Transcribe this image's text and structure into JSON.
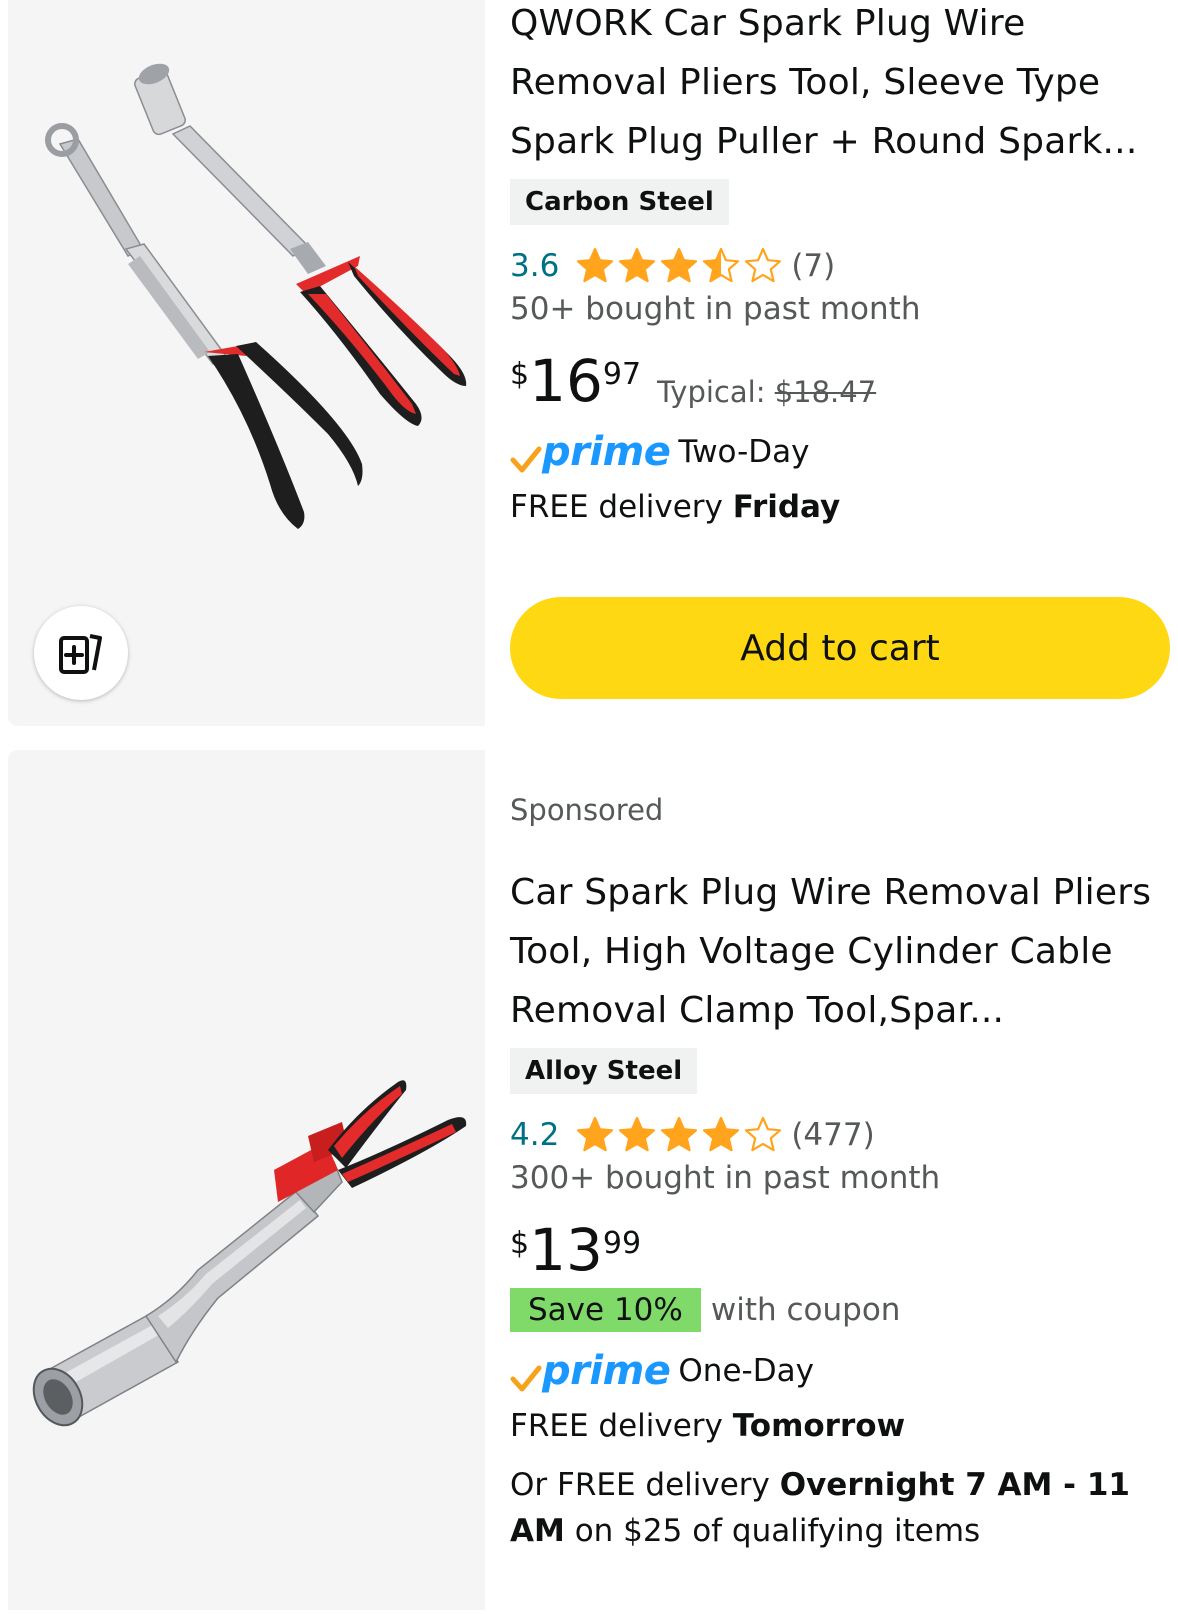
{
  "products": [
    {
      "title": "QWORK Car Spark Plug Wire Removal Pliers Tool, Sleeve Type Spark Plug Puller + Round Spark...",
      "material": "Carbon Steel",
      "rating": "3.6",
      "rating_value": 3.6,
      "rating_count": "(7)",
      "bought": "50+ bought in past month",
      "price_symbol": "$",
      "price_whole": "16",
      "price_fraction": "97",
      "typical_label": "Typical:",
      "typical_price": "$18.47",
      "prime_word": "prime",
      "prime_speed": "Two-Day",
      "delivery_prefix": "FREE delivery",
      "delivery_day": "Friday",
      "add_to_cart": "Add to cart"
    },
    {
      "sponsored": "Sponsored",
      "title": "Car Spark Plug Wire Removal Pliers Tool, High Voltage Cylinder Cable Removal Clamp Tool,Spar...",
      "material": "Alloy Steel",
      "rating": "4.2",
      "rating_value": 4.2,
      "rating_count": "(477)",
      "bought": "300+ bought in past month",
      "price_symbol": "$",
      "price_whole": "13",
      "price_fraction": "99",
      "coupon_badge": "Save 10%",
      "coupon_text": "with coupon",
      "prime_word": "prime",
      "prime_speed": "One-Day",
      "delivery_prefix": "FREE delivery",
      "delivery_day": "Tomorrow",
      "overnight_prefix": "Or FREE delivery",
      "overnight_bold": "Overnight 7 AM - 11 AM",
      "overnight_suffix": "on $25 of qualifying items"
    }
  ],
  "colors": {
    "star": "#ffa41c",
    "link": "#007185",
    "prime_blue": "#1a98ff",
    "prime_check": "#f7a21b",
    "cart_button": "#ffd814",
    "coupon_green": "#7fda69"
  },
  "icons": [
    "compare-icon",
    "star-icon",
    "prime-check-icon"
  ]
}
